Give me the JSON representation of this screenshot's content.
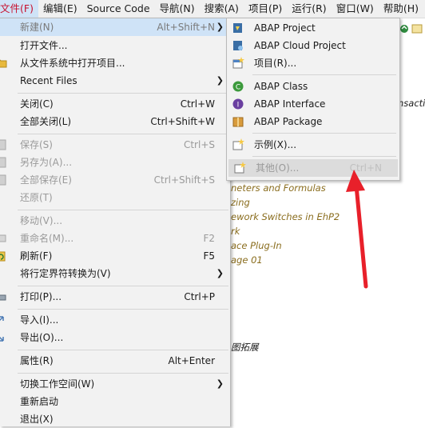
{
  "menubar": {
    "items": [
      "文件(F)",
      "编辑(E)",
      "Source Code",
      "导航(N)",
      "搜索(A)",
      "项目(P)",
      "运行(R)",
      "窗口(W)",
      "帮助(H)"
    ]
  },
  "file_menu": {
    "items": [
      {
        "label": "新建(N)",
        "shortcut": "Alt+Shift+N"
      },
      {
        "label": "打开文件..."
      },
      {
        "label": "从文件系统中打开项目..."
      },
      {
        "label": "Recent Files"
      },
      {
        "label": "关闭(C)",
        "shortcut": "Ctrl+W"
      },
      {
        "label": "全部关闭(L)",
        "shortcut": "Ctrl+Shift+W"
      },
      {
        "label": "保存(S)",
        "shortcut": "Ctrl+S"
      },
      {
        "label": "另存为(A)..."
      },
      {
        "label": "全部保存(E)",
        "shortcut": "Ctrl+Shift+S"
      },
      {
        "label": "还原(T)"
      },
      {
        "label": "移动(V)..."
      },
      {
        "label": "重命名(M)...",
        "shortcut": "F2"
      },
      {
        "label": "刷新(F)",
        "shortcut": "F5"
      },
      {
        "label": "将行定界符转换为(V)"
      },
      {
        "label": "打印(P)...",
        "shortcut": "Ctrl+P"
      },
      {
        "label": "导入(I)..."
      },
      {
        "label": "导出(O)..."
      },
      {
        "label": "属性(R)",
        "shortcut": "Alt+Enter"
      },
      {
        "label": "切换工作空间(W)"
      },
      {
        "label": "重新启动"
      },
      {
        "label": "退出(X)"
      }
    ]
  },
  "new_submenu": {
    "items": [
      {
        "label": "ABAP Project"
      },
      {
        "label": "ABAP Cloud Project"
      },
      {
        "label": "项目(R)..."
      },
      {
        "label": "ABAP Class"
      },
      {
        "label": "ABAP Interface"
      },
      {
        "label": "ABAP Package"
      },
      {
        "label": "示例(X)..."
      },
      {
        "label": "其他(O)...",
        "shortcut": "Ctrl+N"
      }
    ]
  },
  "background": {
    "lines": [
      "nsacti",
      "neters and Formulas",
      "zing",
      "ework Switches in EhP2",
      "rk",
      "ace Plug-In",
      "age 01",
      "图拓展"
    ]
  },
  "colors": {
    "highlight": "#cfe3f7",
    "annotation_arrow": "#e8202a",
    "menu_title": "#c8102e"
  }
}
